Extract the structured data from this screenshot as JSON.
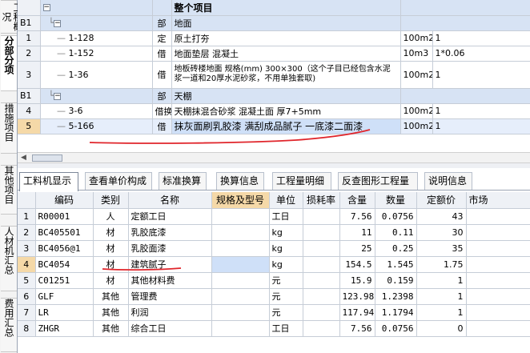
{
  "side_tabs": [
    "工程概况",
    "分部分项",
    "措施项目",
    "其他项目",
    "人材机汇总",
    "费用汇总"
  ],
  "top_grid": {
    "root_title": "整个项目",
    "rows": [
      {
        "num": "B1",
        "code": "",
        "type": "部",
        "name": "地面",
        "unit": "",
        "qty": "",
        "level": 0,
        "group": true
      },
      {
        "num": "1",
        "code": "1-128",
        "type": "定",
        "name": "原土打夯",
        "unit": "100m2",
        "qty": "1"
      },
      {
        "num": "2",
        "code": "1-152",
        "type": "借",
        "name": "地面垫层 混凝土",
        "unit": "10m3",
        "qty": "1*0.06"
      },
      {
        "num": "3",
        "code": "1-36",
        "type": "借",
        "name": "地板砖楼地面 规格(mm) 300×300（这个子目已经包含水泥浆一道和20厚水泥砂浆，不用单独套取)",
        "unit": "100m2",
        "qty": "1"
      },
      {
        "num": "B1",
        "code": "",
        "type": "部",
        "name": "天棚",
        "unit": "",
        "qty": "",
        "group": true
      },
      {
        "num": "4",
        "code": "3-6",
        "type": "借换",
        "name": "天棚抹混合砂浆 混凝土面 厚7+5mm",
        "unit": "100m2",
        "qty": "1"
      },
      {
        "num": "5",
        "code": "5-166",
        "type": "借",
        "name": "抹灰面刷乳胶漆 满刮成品腻子 一底漆二面漆",
        "unit": "100m2",
        "qty": "1",
        "selected": true
      }
    ]
  },
  "tabs": [
    "工料机显示",
    "查看单价构成",
    "标准换算",
    "换算信息",
    "工程量明细",
    "反查图形工程量",
    "说明信息"
  ],
  "bottom_grid": {
    "headers": [
      "编码",
      "类别",
      "名称",
      "规格及型号",
      "单位",
      "损耗率",
      "含量",
      "数量",
      "定额价",
      "市场"
    ],
    "rows": [
      {
        "num": "1",
        "code": "R00001",
        "cat": "人",
        "name": "定额工日",
        "spec": "",
        "unit": "工日",
        "loss": "",
        "content": "7.56",
        "qty": "0.0756",
        "price": "43"
      },
      {
        "num": "2",
        "code": "BC405501",
        "cat": "材",
        "name": "乳胶底漆",
        "spec": "",
        "unit": "kg",
        "loss": "",
        "content": "11",
        "qty": "0.11",
        "price": "30"
      },
      {
        "num": "3",
        "code": "BC4056@1",
        "cat": "材",
        "name": "乳胶面漆",
        "spec": "",
        "unit": "kg",
        "loss": "",
        "content": "25",
        "qty": "0.25",
        "price": "35"
      },
      {
        "num": "4",
        "code": "BC4054",
        "cat": "材",
        "name": "建筑腻子",
        "spec": "",
        "unit": "kg",
        "loss": "",
        "content": "154.5",
        "qty": "1.545",
        "price": "1.75",
        "selected": true
      },
      {
        "num": "5",
        "code": "C01251",
        "cat": "材",
        "name": "其他材料费",
        "spec": "",
        "unit": "元",
        "loss": "",
        "content": "15.9",
        "qty": "0.159",
        "price": "1"
      },
      {
        "num": "6",
        "code": "GLF",
        "cat": "其他",
        "name": "管理费",
        "spec": "",
        "unit": "元",
        "loss": "",
        "content": "123.98",
        "qty": "1.2398",
        "price": "1"
      },
      {
        "num": "7",
        "code": "LR",
        "cat": "其他",
        "name": "利润",
        "spec": "",
        "unit": "元",
        "loss": "",
        "content": "117.94",
        "qty": "1.1794",
        "price": "1"
      },
      {
        "num": "8",
        "code": "ZHGR",
        "cat": "其他",
        "name": "综合工日",
        "spec": "",
        "unit": "工日",
        "loss": "",
        "content": "7.56",
        "qty": "0.0756",
        "price": "0"
      }
    ]
  },
  "colors": {
    "annotation": "#e0252b",
    "group_row": "#d7e3f4",
    "spec_header": "#f5d9a8"
  }
}
